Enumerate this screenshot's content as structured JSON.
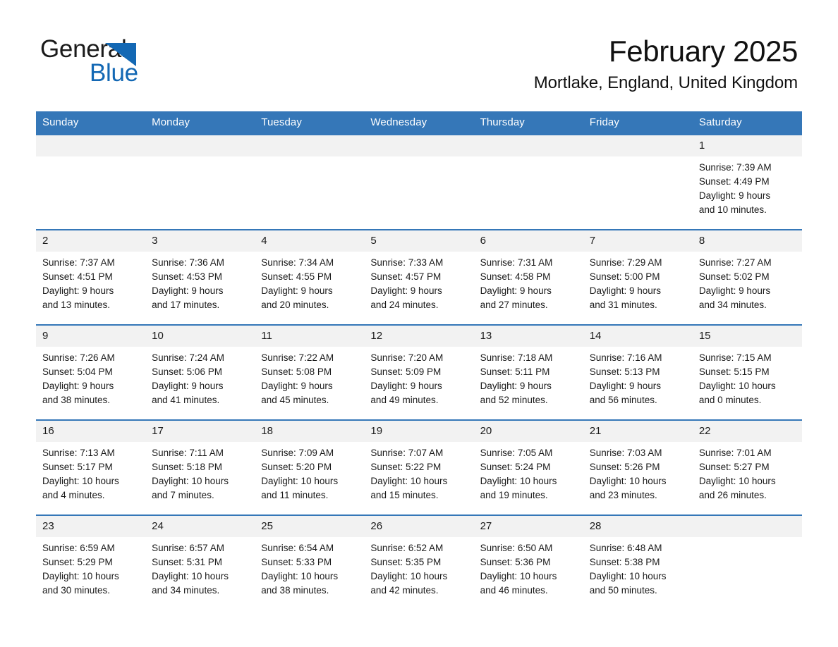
{
  "brand": {
    "name_part1": "General",
    "name_part2": "Blue",
    "accent_color": "#1368b4",
    "triangle_icon": "triangle-icon"
  },
  "header": {
    "title": "February 2025",
    "subtitle": "Mortlake, England, United Kingdom"
  },
  "calendar": {
    "header_bg": "#3577b8",
    "daynum_bg": "#f2f2f2",
    "weekday_headers": [
      "Sunday",
      "Monday",
      "Tuesday",
      "Wednesday",
      "Thursday",
      "Friday",
      "Saturday"
    ],
    "weeks": [
      [
        {
          "day": "",
          "sunrise": "",
          "sunset": "",
          "daylight1": "",
          "daylight2": ""
        },
        {
          "day": "",
          "sunrise": "",
          "sunset": "",
          "daylight1": "",
          "daylight2": ""
        },
        {
          "day": "",
          "sunrise": "",
          "sunset": "",
          "daylight1": "",
          "daylight2": ""
        },
        {
          "day": "",
          "sunrise": "",
          "sunset": "",
          "daylight1": "",
          "daylight2": ""
        },
        {
          "day": "",
          "sunrise": "",
          "sunset": "",
          "daylight1": "",
          "daylight2": ""
        },
        {
          "day": "",
          "sunrise": "",
          "sunset": "",
          "daylight1": "",
          "daylight2": ""
        },
        {
          "day": "1",
          "sunrise": "Sunrise: 7:39 AM",
          "sunset": "Sunset: 4:49 PM",
          "daylight1": "Daylight: 9 hours",
          "daylight2": "and 10 minutes."
        }
      ],
      [
        {
          "day": "2",
          "sunrise": "Sunrise: 7:37 AM",
          "sunset": "Sunset: 4:51 PM",
          "daylight1": "Daylight: 9 hours",
          "daylight2": "and 13 minutes."
        },
        {
          "day": "3",
          "sunrise": "Sunrise: 7:36 AM",
          "sunset": "Sunset: 4:53 PM",
          "daylight1": "Daylight: 9 hours",
          "daylight2": "and 17 minutes."
        },
        {
          "day": "4",
          "sunrise": "Sunrise: 7:34 AM",
          "sunset": "Sunset: 4:55 PM",
          "daylight1": "Daylight: 9 hours",
          "daylight2": "and 20 minutes."
        },
        {
          "day": "5",
          "sunrise": "Sunrise: 7:33 AM",
          "sunset": "Sunset: 4:57 PM",
          "daylight1": "Daylight: 9 hours",
          "daylight2": "and 24 minutes."
        },
        {
          "day": "6",
          "sunrise": "Sunrise: 7:31 AM",
          "sunset": "Sunset: 4:58 PM",
          "daylight1": "Daylight: 9 hours",
          "daylight2": "and 27 minutes."
        },
        {
          "day": "7",
          "sunrise": "Sunrise: 7:29 AM",
          "sunset": "Sunset: 5:00 PM",
          "daylight1": "Daylight: 9 hours",
          "daylight2": "and 31 minutes."
        },
        {
          "day": "8",
          "sunrise": "Sunrise: 7:27 AM",
          "sunset": "Sunset: 5:02 PM",
          "daylight1": "Daylight: 9 hours",
          "daylight2": "and 34 minutes."
        }
      ],
      [
        {
          "day": "9",
          "sunrise": "Sunrise: 7:26 AM",
          "sunset": "Sunset: 5:04 PM",
          "daylight1": "Daylight: 9 hours",
          "daylight2": "and 38 minutes."
        },
        {
          "day": "10",
          "sunrise": "Sunrise: 7:24 AM",
          "sunset": "Sunset: 5:06 PM",
          "daylight1": "Daylight: 9 hours",
          "daylight2": "and 41 minutes."
        },
        {
          "day": "11",
          "sunrise": "Sunrise: 7:22 AM",
          "sunset": "Sunset: 5:08 PM",
          "daylight1": "Daylight: 9 hours",
          "daylight2": "and 45 minutes."
        },
        {
          "day": "12",
          "sunrise": "Sunrise: 7:20 AM",
          "sunset": "Sunset: 5:09 PM",
          "daylight1": "Daylight: 9 hours",
          "daylight2": "and 49 minutes."
        },
        {
          "day": "13",
          "sunrise": "Sunrise: 7:18 AM",
          "sunset": "Sunset: 5:11 PM",
          "daylight1": "Daylight: 9 hours",
          "daylight2": "and 52 minutes."
        },
        {
          "day": "14",
          "sunrise": "Sunrise: 7:16 AM",
          "sunset": "Sunset: 5:13 PM",
          "daylight1": "Daylight: 9 hours",
          "daylight2": "and 56 minutes."
        },
        {
          "day": "15",
          "sunrise": "Sunrise: 7:15 AM",
          "sunset": "Sunset: 5:15 PM",
          "daylight1": "Daylight: 10 hours",
          "daylight2": "and 0 minutes."
        }
      ],
      [
        {
          "day": "16",
          "sunrise": "Sunrise: 7:13 AM",
          "sunset": "Sunset: 5:17 PM",
          "daylight1": "Daylight: 10 hours",
          "daylight2": "and 4 minutes."
        },
        {
          "day": "17",
          "sunrise": "Sunrise: 7:11 AM",
          "sunset": "Sunset: 5:18 PM",
          "daylight1": "Daylight: 10 hours",
          "daylight2": "and 7 minutes."
        },
        {
          "day": "18",
          "sunrise": "Sunrise: 7:09 AM",
          "sunset": "Sunset: 5:20 PM",
          "daylight1": "Daylight: 10 hours",
          "daylight2": "and 11 minutes."
        },
        {
          "day": "19",
          "sunrise": "Sunrise: 7:07 AM",
          "sunset": "Sunset: 5:22 PM",
          "daylight1": "Daylight: 10 hours",
          "daylight2": "and 15 minutes."
        },
        {
          "day": "20",
          "sunrise": "Sunrise: 7:05 AM",
          "sunset": "Sunset: 5:24 PM",
          "daylight1": "Daylight: 10 hours",
          "daylight2": "and 19 minutes."
        },
        {
          "day": "21",
          "sunrise": "Sunrise: 7:03 AM",
          "sunset": "Sunset: 5:26 PM",
          "daylight1": "Daylight: 10 hours",
          "daylight2": "and 23 minutes."
        },
        {
          "day": "22",
          "sunrise": "Sunrise: 7:01 AM",
          "sunset": "Sunset: 5:27 PM",
          "daylight1": "Daylight: 10 hours",
          "daylight2": "and 26 minutes."
        }
      ],
      [
        {
          "day": "23",
          "sunrise": "Sunrise: 6:59 AM",
          "sunset": "Sunset: 5:29 PM",
          "daylight1": "Daylight: 10 hours",
          "daylight2": "and 30 minutes."
        },
        {
          "day": "24",
          "sunrise": "Sunrise: 6:57 AM",
          "sunset": "Sunset: 5:31 PM",
          "daylight1": "Daylight: 10 hours",
          "daylight2": "and 34 minutes."
        },
        {
          "day": "25",
          "sunrise": "Sunrise: 6:54 AM",
          "sunset": "Sunset: 5:33 PM",
          "daylight1": "Daylight: 10 hours",
          "daylight2": "and 38 minutes."
        },
        {
          "day": "26",
          "sunrise": "Sunrise: 6:52 AM",
          "sunset": "Sunset: 5:35 PM",
          "daylight1": "Daylight: 10 hours",
          "daylight2": "and 42 minutes."
        },
        {
          "day": "27",
          "sunrise": "Sunrise: 6:50 AM",
          "sunset": "Sunset: 5:36 PM",
          "daylight1": "Daylight: 10 hours",
          "daylight2": "and 46 minutes."
        },
        {
          "day": "28",
          "sunrise": "Sunrise: 6:48 AM",
          "sunset": "Sunset: 5:38 PM",
          "daylight1": "Daylight: 10 hours",
          "daylight2": "and 50 minutes."
        },
        {
          "day": "",
          "sunrise": "",
          "sunset": "",
          "daylight1": "",
          "daylight2": ""
        }
      ]
    ]
  }
}
